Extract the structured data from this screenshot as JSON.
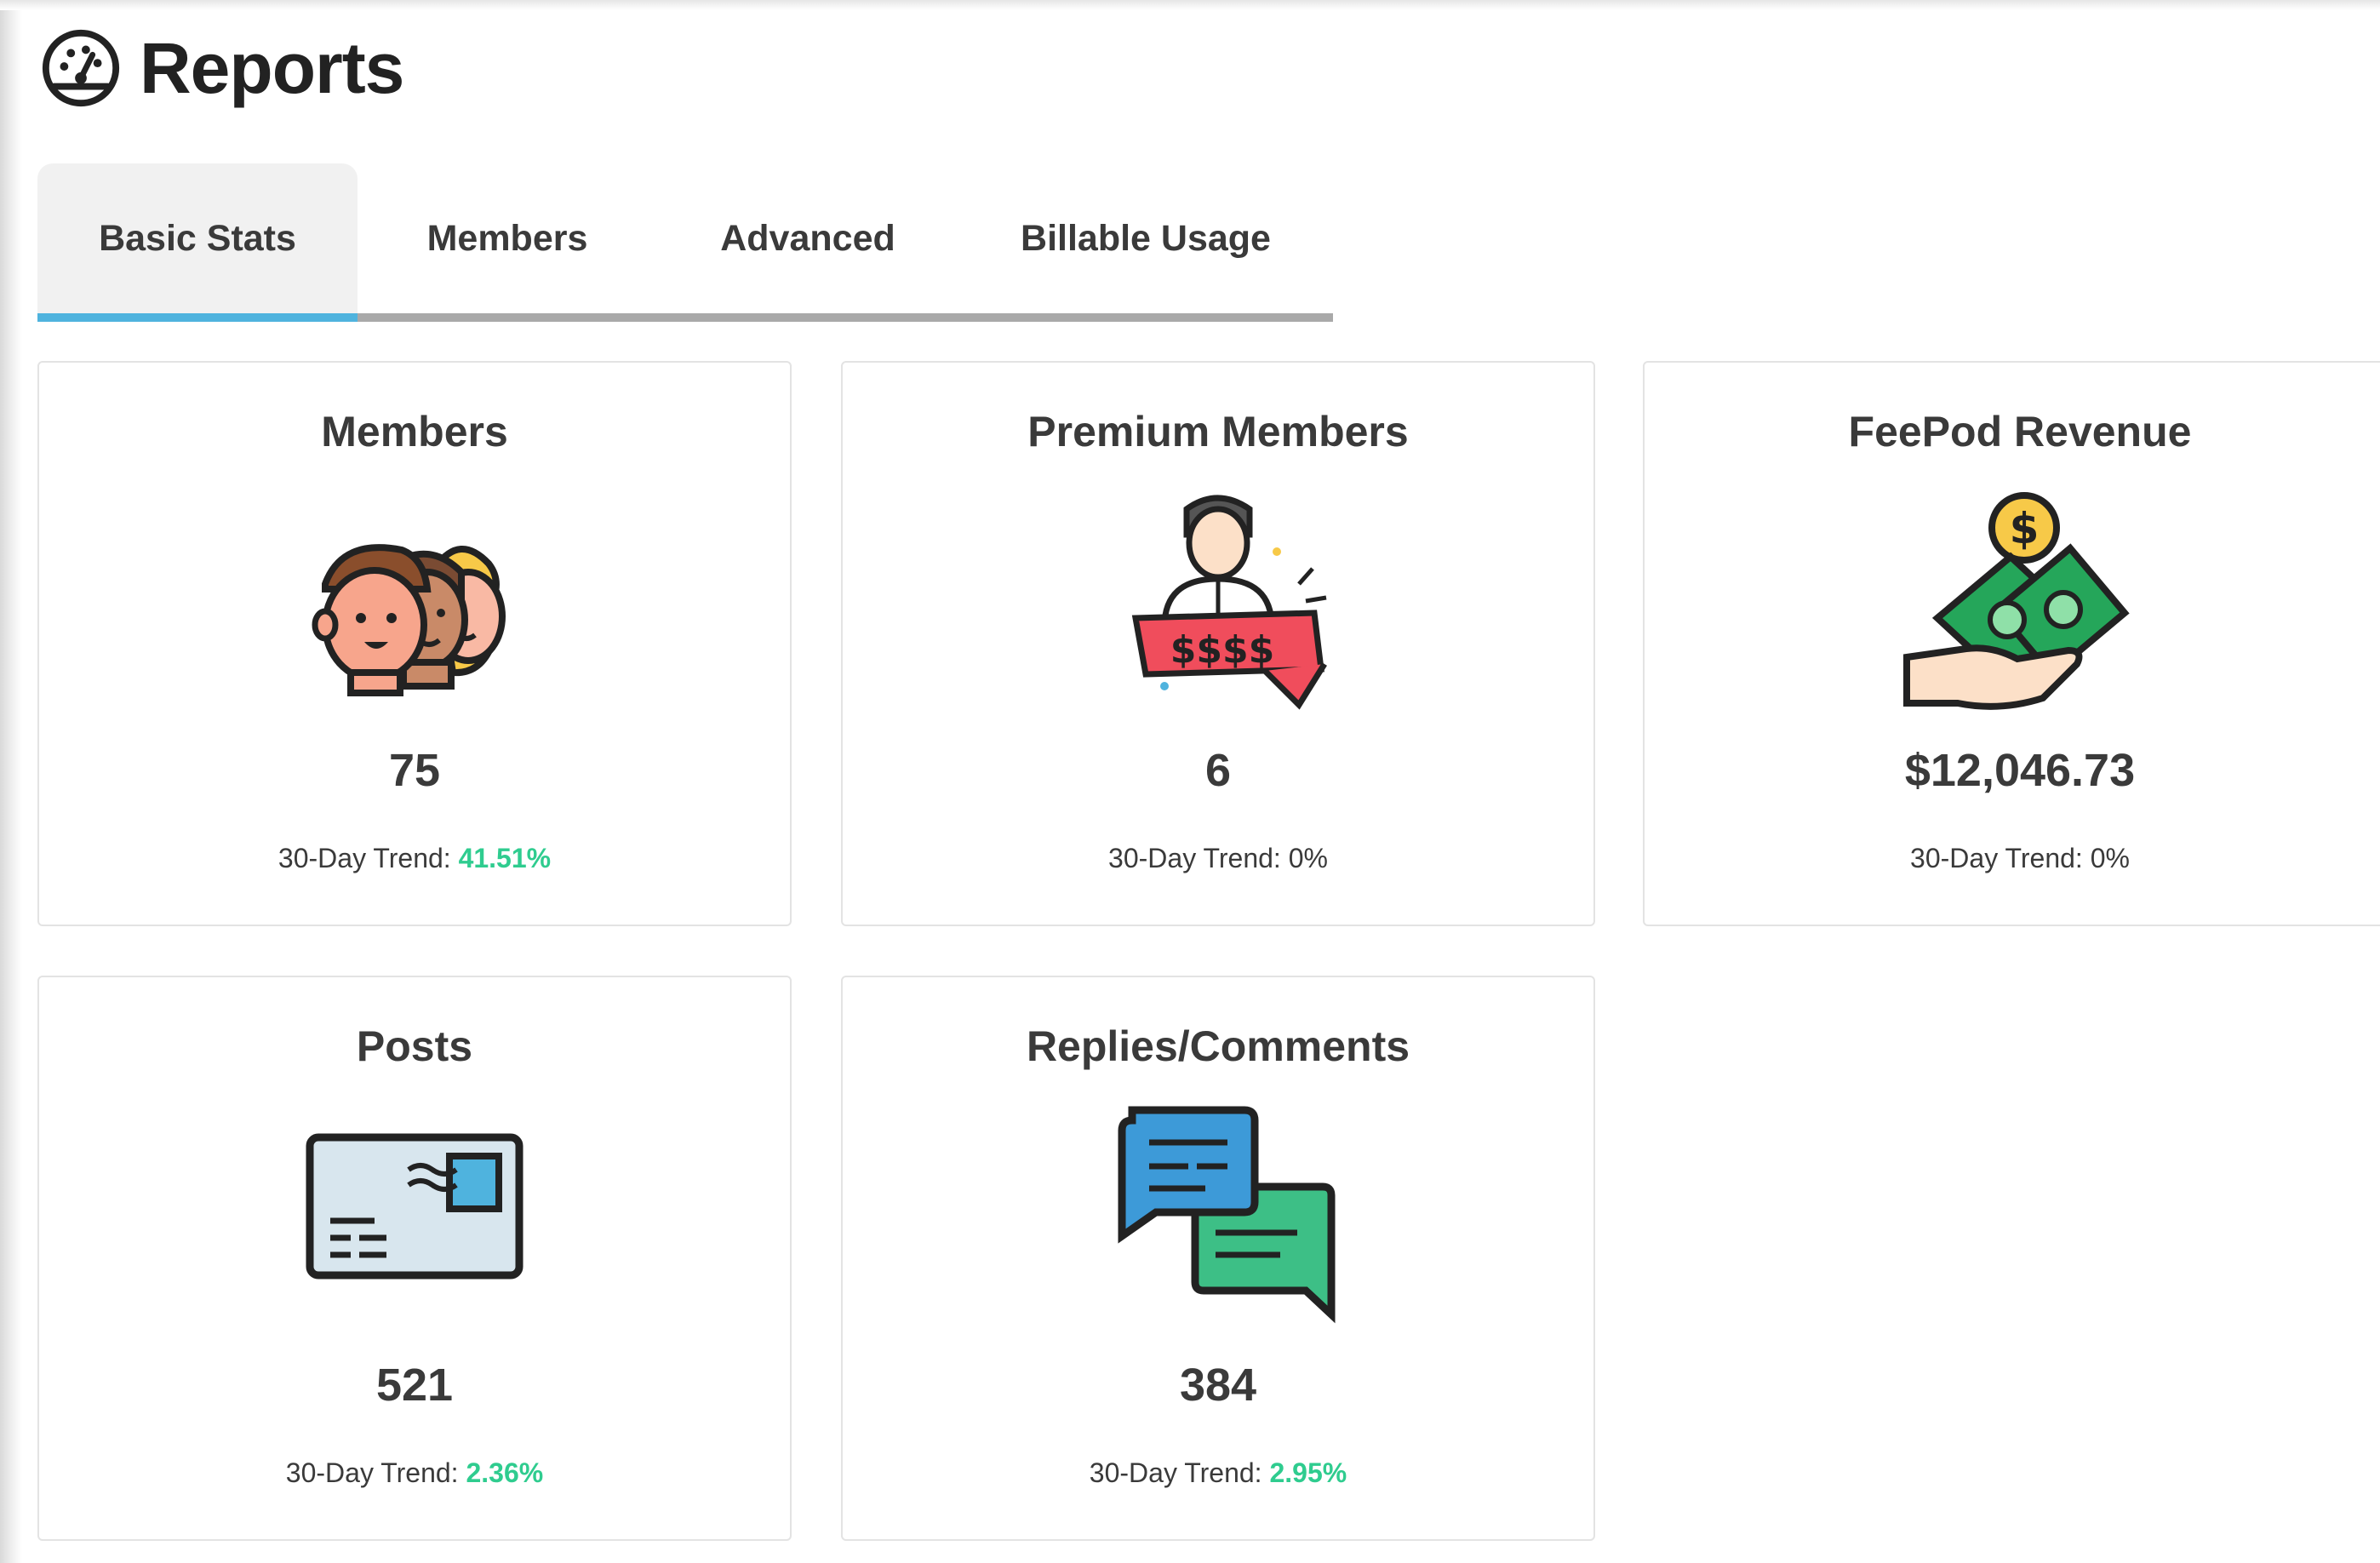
{
  "header": {
    "title": "Reports",
    "icon": "speedometer-icon"
  },
  "tabs": [
    {
      "label": "Basic Stats",
      "active": true
    },
    {
      "label": "Members",
      "active": false
    },
    {
      "label": "Advanced",
      "active": false
    },
    {
      "label": "Billable Usage",
      "active": false
    }
  ],
  "colors": {
    "accent": "#4fb3de",
    "positive_trend": "#2fcc8f",
    "tab_active_bg": "#f1f1f1"
  },
  "cards": [
    {
      "title": "Members",
      "icon": "members-group-icon",
      "value": "75",
      "trend_label": "30-Day Trend:",
      "trend_value": "41.51%",
      "trend_positive": true
    },
    {
      "title": "Premium Members",
      "icon": "premium-member-icon",
      "value": "6",
      "trend_label": "30-Day Trend:",
      "trend_value": "0%",
      "trend_positive": false
    },
    {
      "title": "FeePod Revenue",
      "icon": "revenue-money-icon",
      "value": "$12,046.73",
      "trend_label": "30-Day Trend:",
      "trend_value": "0%",
      "trend_positive": false
    },
    {
      "title": "Posts",
      "icon": "post-card-icon",
      "value": "521",
      "trend_label": "30-Day Trend:",
      "trend_value": "2.36%",
      "trend_positive": true
    },
    {
      "title": "Replies/Comments",
      "icon": "comments-chat-icon",
      "value": "384",
      "trend_label": "30-Day Trend:",
      "trend_value": "2.95%",
      "trend_positive": true
    }
  ]
}
